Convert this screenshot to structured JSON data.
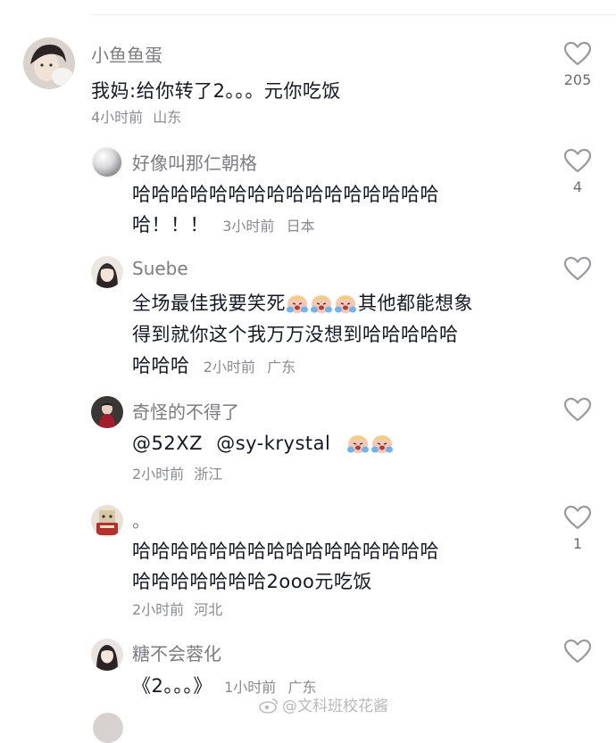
{
  "comments": [
    {
      "username": "小鱼鱼蛋",
      "lines": [
        "我妈:给你转了2。。。元你吃饭"
      ],
      "time": "4小时前",
      "location": "山东",
      "likes": "205"
    },
    {
      "username": "好像叫那仁朝格",
      "lines": [
        "哈哈哈哈哈哈哈哈哈哈哈哈哈哈哈哈",
        "哈！！！"
      ],
      "time": "3小时前",
      "location": "日本",
      "likes": "4"
    },
    {
      "username": "Suebe",
      "line1_a": "全场最佳我要笑死",
      "line1_b": "其他都能想象",
      "line2": "得到就你这个我万万没想到哈哈哈哈哈",
      "line3": "哈哈哈",
      "emojis": [
        "loudly-crying-face-emoji",
        "loudly-crying-face-emoji",
        "loudly-crying-face-emoji"
      ],
      "time": "2小时前",
      "location": "广东",
      "likes": ""
    },
    {
      "username": "奇怪的不得了",
      "mentions": [
        "@52XZ",
        "@sy-krystal"
      ],
      "emojis": [
        "loudly-crying-face-emoji",
        "loudly-crying-face-emoji"
      ],
      "time": "2小时前",
      "location": "浙江",
      "likes": ""
    },
    {
      "username": "。",
      "lines": [
        "哈哈哈哈哈哈哈哈哈哈哈哈哈哈哈哈",
        "哈哈哈哈哈哈哈2ooo元吃饭"
      ],
      "time": "2小时前",
      "location": "河北",
      "likes": "1"
    },
    {
      "username": "糖不会蓉化",
      "lines": [
        "《2。。。》"
      ],
      "time": "1小时前",
      "location": "广东",
      "likes": ""
    }
  ],
  "watermark": "@文科班校花酱",
  "icons": {
    "like": "heart-outline-icon",
    "watermark": "weibo-logo-icon"
  },
  "colors": {
    "text": "#161823",
    "username": "#7c7c82",
    "meta": "#8a8b91",
    "heart": "#9a9ba1"
  }
}
